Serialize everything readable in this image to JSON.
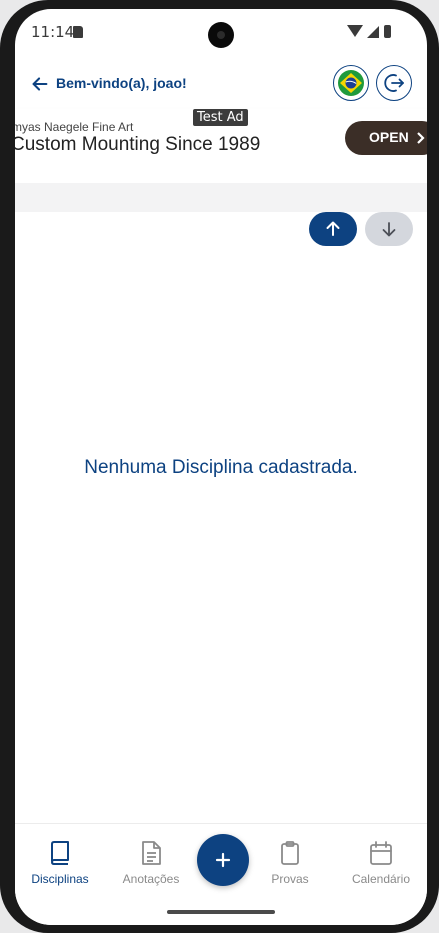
{
  "status_bar": {
    "time": "11:14"
  },
  "app_bar": {
    "welcome_text": "Bem-vindo(a), joao!",
    "language_flag": "brazil-flag-icon",
    "logout_icon": "logout-icon"
  },
  "ad": {
    "badge": "Test Ad",
    "advertiser": "myas Naegele Fine Art",
    "headline": "Custom Mounting Since 1989",
    "cta": "OPEN"
  },
  "sort": {
    "ascending_icon": "arrow-up-icon",
    "descending_icon": "arrow-down-icon"
  },
  "main": {
    "empty_message": "Nenhuma Disciplina cadastrada."
  },
  "bottom_nav": {
    "items": [
      {
        "label": "Disciplinas",
        "icon": "book-icon",
        "active": true
      },
      {
        "label": "Anotações",
        "icon": "note-icon",
        "active": false
      },
      {
        "label": "Provas",
        "icon": "clipboard-icon",
        "active": false
      },
      {
        "label": "Calendário",
        "icon": "calendar-icon",
        "active": false
      }
    ],
    "fab_icon": "plus-icon"
  },
  "colors": {
    "primary": "#0d4281",
    "inactive": "#8a8a8a",
    "sort_inactive": "#d4d7dd",
    "ad_button": "#3b2e27"
  }
}
